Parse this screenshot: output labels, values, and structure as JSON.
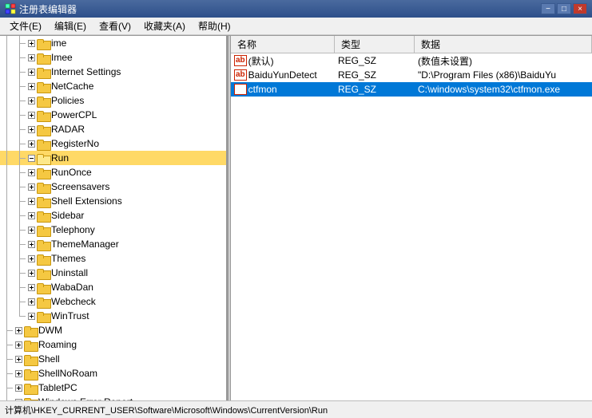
{
  "titleBar": {
    "icon": "regedit",
    "title": "注册表编辑器",
    "minimizeLabel": "−",
    "maximizeLabel": "□",
    "closeLabel": "×"
  },
  "menuBar": {
    "items": [
      {
        "id": "file",
        "label": "文件(E)"
      },
      {
        "id": "edit",
        "label": "编辑(E)"
      },
      {
        "id": "view",
        "label": "查看(V)"
      },
      {
        "id": "favorites",
        "label": "收藏夹(A)"
      },
      {
        "id": "help",
        "label": "帮助(H)"
      }
    ]
  },
  "treePanel": {
    "items": [
      {
        "id": "ime",
        "label": "ime",
        "depth": 1,
        "expanded": false,
        "lines": [
          "v",
          "t"
        ]
      },
      {
        "id": "imee",
        "label": "Imee",
        "depth": 1,
        "expanded": false,
        "lines": [
          "v",
          "t"
        ]
      },
      {
        "id": "internetsettings",
        "label": "Internet Settings",
        "depth": 1,
        "expanded": false,
        "lines": [
          "v",
          "t"
        ]
      },
      {
        "id": "netcache",
        "label": "NetCache",
        "depth": 1,
        "expanded": false,
        "lines": [
          "v",
          "t"
        ]
      },
      {
        "id": "policies",
        "label": "Policies",
        "depth": 1,
        "expanded": false,
        "lines": [
          "v",
          "t"
        ]
      },
      {
        "id": "powercpl",
        "label": "PowerCPL",
        "depth": 1,
        "expanded": false,
        "lines": [
          "v",
          "t"
        ]
      },
      {
        "id": "radar",
        "label": "RADAR",
        "depth": 1,
        "expanded": false,
        "lines": [
          "v",
          "t"
        ]
      },
      {
        "id": "registerno",
        "label": "RegisterNo",
        "depth": 1,
        "expanded": false,
        "lines": [
          "v",
          "t"
        ]
      },
      {
        "id": "run",
        "label": "Run",
        "depth": 1,
        "expanded": true,
        "selected": true,
        "lines": [
          "v",
          "t"
        ]
      },
      {
        "id": "runonce",
        "label": "RunOnce",
        "depth": 1,
        "expanded": false,
        "lines": [
          "v",
          "t"
        ]
      },
      {
        "id": "screensavers",
        "label": "Screensavers",
        "depth": 1,
        "expanded": false,
        "lines": [
          "v",
          "t"
        ]
      },
      {
        "id": "shellextensions",
        "label": "Shell Extensions",
        "depth": 1,
        "expanded": false,
        "lines": [
          "v",
          "t"
        ]
      },
      {
        "id": "sidebar",
        "label": "Sidebar",
        "depth": 1,
        "expanded": false,
        "lines": [
          "v",
          "t"
        ]
      },
      {
        "id": "telephony",
        "label": "Telephony",
        "depth": 1,
        "expanded": false,
        "lines": [
          "v",
          "t"
        ]
      },
      {
        "id": "thememanager",
        "label": "ThemeManager",
        "depth": 1,
        "expanded": false,
        "lines": [
          "v",
          "t"
        ]
      },
      {
        "id": "themes",
        "label": "Themes",
        "depth": 1,
        "expanded": false,
        "lines": [
          "v",
          "t"
        ]
      },
      {
        "id": "uninstall",
        "label": "Uninstall",
        "depth": 1,
        "expanded": false,
        "lines": [
          "v",
          "t"
        ]
      },
      {
        "id": "wabadan",
        "label": "WabaDan",
        "depth": 1,
        "expanded": false,
        "lines": [
          "v",
          "t"
        ]
      },
      {
        "id": "webcheck",
        "label": "Webcheck",
        "depth": 1,
        "expanded": false,
        "lines": [
          "v",
          "t"
        ]
      },
      {
        "id": "wintrust",
        "label": "WinTrust",
        "depth": 1,
        "expanded": false,
        "lines": [
          "v",
          "l"
        ]
      },
      {
        "id": "dwm",
        "label": "DWM",
        "depth": 0,
        "expanded": false,
        "lines": [
          "t"
        ]
      },
      {
        "id": "roaming",
        "label": "Roaming",
        "depth": 0,
        "expanded": false,
        "lines": [
          "t"
        ]
      },
      {
        "id": "shell",
        "label": "Shell",
        "depth": 0,
        "expanded": false,
        "lines": [
          "t"
        ]
      },
      {
        "id": "shellnoroam",
        "label": "ShellNoRoam",
        "depth": 0,
        "expanded": false,
        "lines": [
          "t"
        ]
      },
      {
        "id": "tabletpc",
        "label": "TabletPC",
        "depth": 0,
        "expanded": false,
        "lines": [
          "t"
        ]
      },
      {
        "id": "windowserrorreport",
        "label": "Windows Error Report",
        "depth": 0,
        "expanded": false,
        "lines": [
          "t"
        ]
      }
    ]
  },
  "rightPanel": {
    "columns": {
      "name": "名称",
      "type": "类型",
      "data": "数据"
    },
    "rows": [
      {
        "id": "default",
        "name": "(默认)",
        "type": "REG_SZ",
        "data": "(数值未设置)"
      },
      {
        "id": "baiduyundetect",
        "name": "BaiduYunDetect",
        "type": "REG_SZ",
        "data": "\"D:\\Program Files (x86)\\BaiduYu"
      },
      {
        "id": "ctfmon",
        "name": "ctfmon",
        "type": "REG_SZ",
        "data": "C:\\windows\\system32\\ctfmon.exe",
        "selected": true
      }
    ]
  },
  "statusBar": {
    "path": "计算机\\HKEY_CURRENT_USER\\Software\\Microsoft\\Windows\\CurrentVersion\\Run"
  }
}
